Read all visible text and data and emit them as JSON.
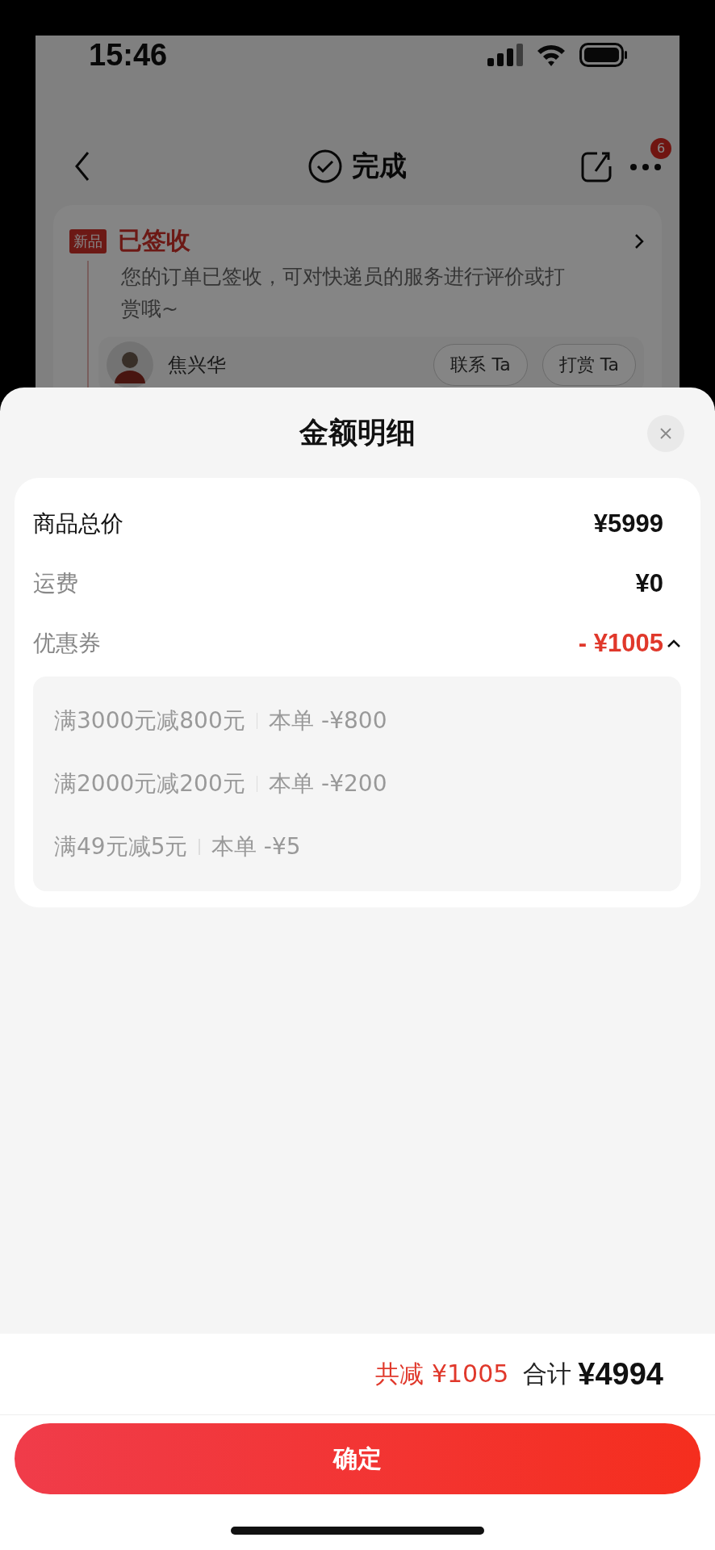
{
  "status_bar": {
    "time": "15:46"
  },
  "nav": {
    "title": "完成",
    "badge": "6"
  },
  "order_status": {
    "tag": "新品",
    "title": "已签收",
    "description": "您的订单已签收，可对快递员的服务进行评价或打赏哦~",
    "courier": {
      "name": "焦兴华",
      "buttons": [
        "联系 Ta",
        "打赏 Ta"
      ]
    }
  },
  "sheet": {
    "title": "金额明细",
    "rows": [
      {
        "label": "商品总价",
        "value": "¥5999",
        "kind": "total"
      },
      {
        "label": "运费",
        "value": "¥0",
        "kind": "plain"
      },
      {
        "label": "优惠券",
        "value": "- ¥1005",
        "kind": "discount",
        "expanded": true
      }
    ],
    "coupons": [
      {
        "rule": "满3000元减800元",
        "deduction": "本单 -¥800"
      },
      {
        "rule": "满2000元减200元",
        "deduction": "本单 -¥200"
      },
      {
        "rule": "满49元减5元",
        "deduction": "本单 -¥5"
      }
    ],
    "summary": {
      "saved": "共减 ¥1005",
      "total_label": "合计",
      "total": "¥4994"
    },
    "confirm": "确定"
  }
}
